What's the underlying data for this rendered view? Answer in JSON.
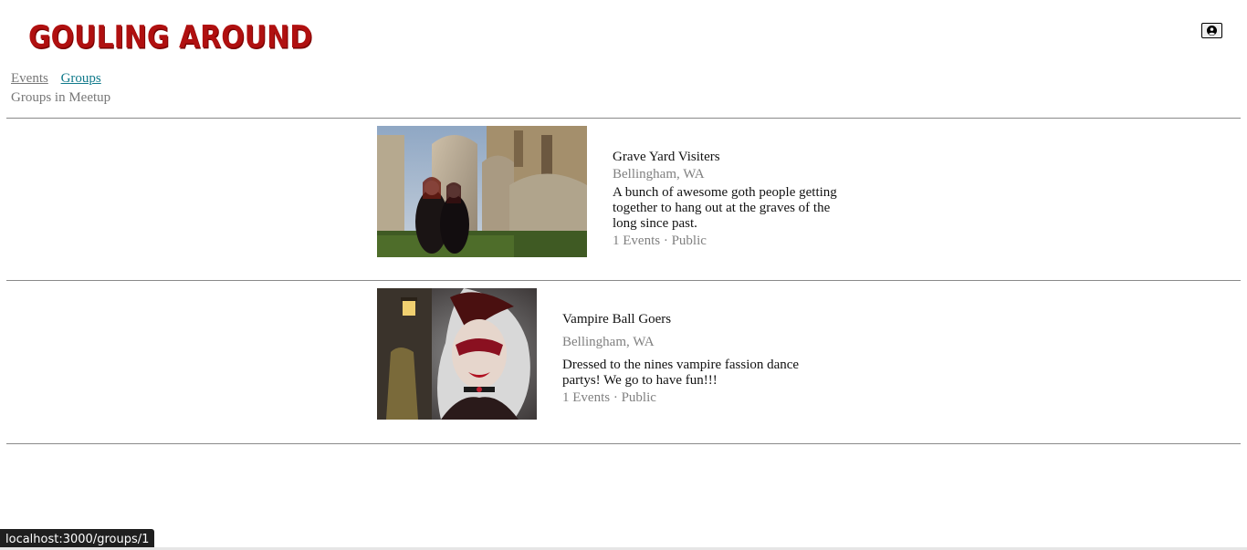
{
  "header": {
    "logo_text": "GOULING AROUND",
    "profile_icon": "user-circle-icon"
  },
  "nav": {
    "events_label": "Events",
    "groups_label": "Groups"
  },
  "page": {
    "subtitle": "Groups in Meetup"
  },
  "groups": [
    {
      "name": "Grave Yard Visiters",
      "location": "Bellingham, WA",
      "description": "A bunch of awesome goth people getting together to hang out at the graves of the long since past.",
      "meta": "1 Events · Public"
    },
    {
      "name": "Vampire Ball Goers",
      "location": "Bellingham, WA",
      "description": "Dressed to the nines vampire fassion dance partys! We go to have fun!!!",
      "meta": "1 Events · Public"
    }
  ],
  "status_bar": {
    "url": "localhost:3000/groups/1"
  },
  "colors": {
    "logo": "#b01010",
    "link_active": "#117a8b",
    "muted_text": "#808080"
  }
}
